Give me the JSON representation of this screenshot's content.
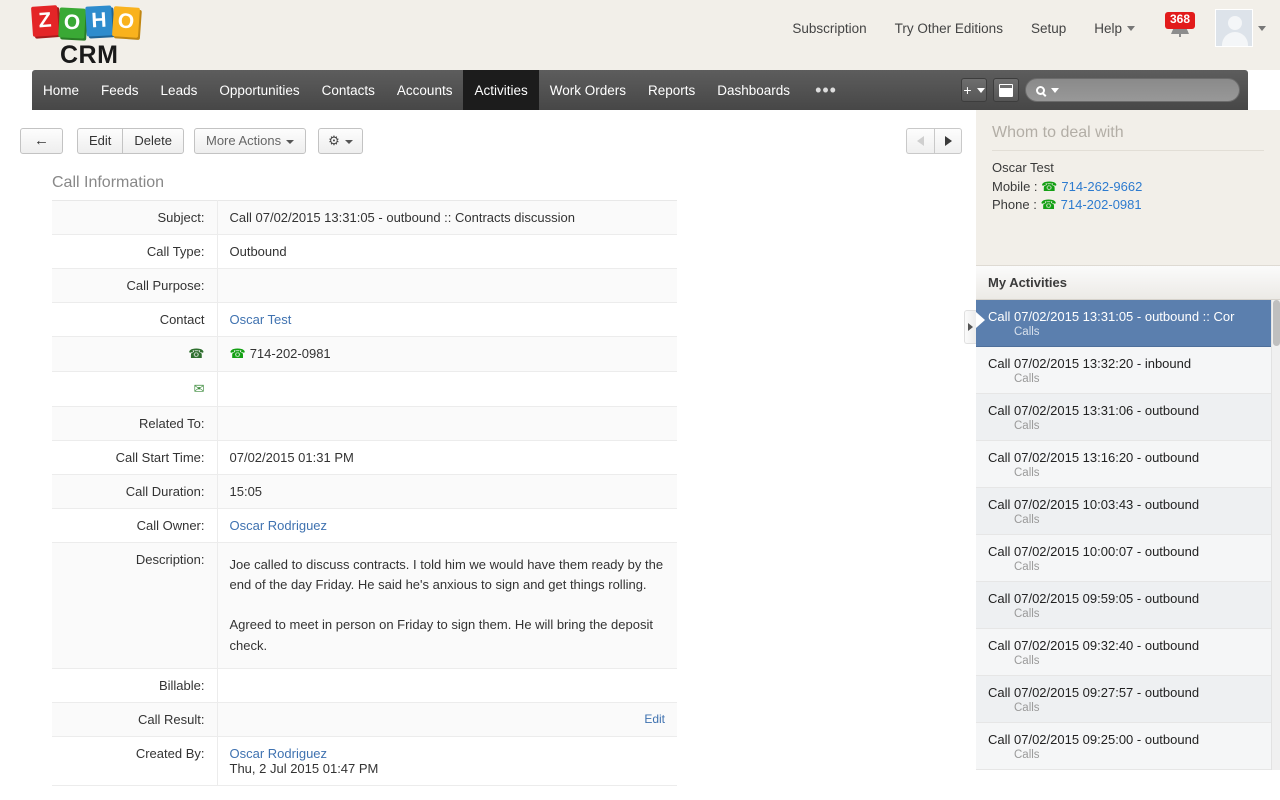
{
  "header": {
    "logo": {
      "blocks": [
        "Z",
        "O",
        "H",
        "O"
      ],
      "product": "CRM"
    },
    "links": [
      {
        "label": "Subscription"
      },
      {
        "label": "Try Other Editions"
      },
      {
        "label": "Setup"
      },
      {
        "label": "Help"
      }
    ],
    "notification_count": "368",
    "notification_color": "#e21b1b",
    "icons": {
      "bell": "bell-icon",
      "avatar": "avatar"
    }
  },
  "nav": {
    "items": [
      {
        "label": "Home",
        "active": false
      },
      {
        "label": "Feeds",
        "active": false
      },
      {
        "label": "Leads",
        "active": false
      },
      {
        "label": "Opportunities",
        "active": false
      },
      {
        "label": "Contacts",
        "active": false
      },
      {
        "label": "Accounts",
        "active": false
      },
      {
        "label": "Activities",
        "active": true
      },
      {
        "label": "Work Orders",
        "active": false
      },
      {
        "label": "Reports",
        "active": false
      },
      {
        "label": "Dashboards",
        "active": false
      }
    ],
    "more_label": "•••",
    "add_label": "+",
    "search_placeholder": "",
    "search_value": ""
  },
  "toolbar": {
    "back_label": "←",
    "edit_label": "Edit",
    "delete_label": "Delete",
    "more_actions_label": "More Actions",
    "gear_label": "⚙"
  },
  "main": {
    "section_title": "Call Information",
    "rows": [
      {
        "label": "Subject:",
        "value": "Call 07/02/2015 13:31:05 - outbound :: Contracts discussion",
        "type": "text"
      },
      {
        "label": "Call Type:",
        "value": "Outbound",
        "type": "text"
      },
      {
        "label": "Call Purpose:",
        "value": "",
        "type": "text"
      },
      {
        "label": "Contact",
        "value": "Oscar Test",
        "type": "link"
      },
      {
        "label": "",
        "value": "714-202-0981",
        "type": "phone",
        "label_icon": "telephone-icon"
      },
      {
        "label": "",
        "value": "",
        "type": "text",
        "label_icon": "envelope-icon"
      },
      {
        "label": "Related To:",
        "value": "",
        "type": "text"
      },
      {
        "label": "Call Start Time:",
        "value": "07/02/2015 01:31 PM",
        "type": "text"
      },
      {
        "label": "Call Duration:",
        "value": "15:05",
        "type": "text"
      },
      {
        "label": "Call Owner:",
        "value": "Oscar Rodriguez",
        "type": "link"
      },
      {
        "label": "Description:",
        "value": "Joe called to discuss contracts.  I told him we would have them ready by the end of the day Friday.  He said he's anxious to sign and get things rolling.\n\nAgreed to meet in person on Friday to sign them.  He will bring the deposit check.",
        "type": "description"
      },
      {
        "label": "Billable:",
        "value": "",
        "type": "text"
      },
      {
        "label": "Call Result:",
        "value": "",
        "type": "text",
        "edit_link": "Edit"
      },
      {
        "label": "Created By:",
        "value": "Oscar Rodriguez",
        "type": "link",
        "subvalue": "Thu, 2 Jul 2015 01:47 PM"
      }
    ]
  },
  "sidebar": {
    "whom_title": "Whom to deal with",
    "contact": {
      "name": "Oscar Test",
      "mobile_label": "Mobile :",
      "mobile": "714-262-9662",
      "phone_label": "Phone :",
      "phone": "714-202-0981"
    },
    "activities_title": "My Activities",
    "activities": [
      {
        "title": "Call 07/02/2015 13:31:05 - outbound :: Cor",
        "subtitle": "Calls",
        "selected": true
      },
      {
        "title": "Call 07/02/2015 13:32:20 - inbound",
        "subtitle": "Calls",
        "selected": false
      },
      {
        "title": "Call 07/02/2015 13:31:06 - outbound",
        "subtitle": "Calls",
        "selected": false
      },
      {
        "title": "Call 07/02/2015 13:16:20 - outbound",
        "subtitle": "Calls",
        "selected": false
      },
      {
        "title": "Call 07/02/2015 10:03:43 - outbound",
        "subtitle": "Calls",
        "selected": false
      },
      {
        "title": "Call 07/02/2015 10:00:07 - outbound",
        "subtitle": "Calls",
        "selected": false
      },
      {
        "title": "Call 07/02/2015 09:59:05 - outbound",
        "subtitle": "Calls",
        "selected": false
      },
      {
        "title": "Call 07/02/2015 09:32:40 - outbound",
        "subtitle": "Calls",
        "selected": false
      },
      {
        "title": "Call 07/02/2015 09:27:57 - outbound",
        "subtitle": "Calls",
        "selected": false
      },
      {
        "title": "Call 07/02/2015 09:25:00 - outbound",
        "subtitle": "Calls",
        "selected": false
      }
    ]
  },
  "colors": {
    "page_bg": "#f2efe9",
    "nav_bg": "#4f4f4f",
    "nav_active": "#1c1c1c",
    "link": "#3f72b0",
    "selected_row": "#5b7fae",
    "phone_green": "#14a014",
    "badge_red": "#e21b1b"
  }
}
